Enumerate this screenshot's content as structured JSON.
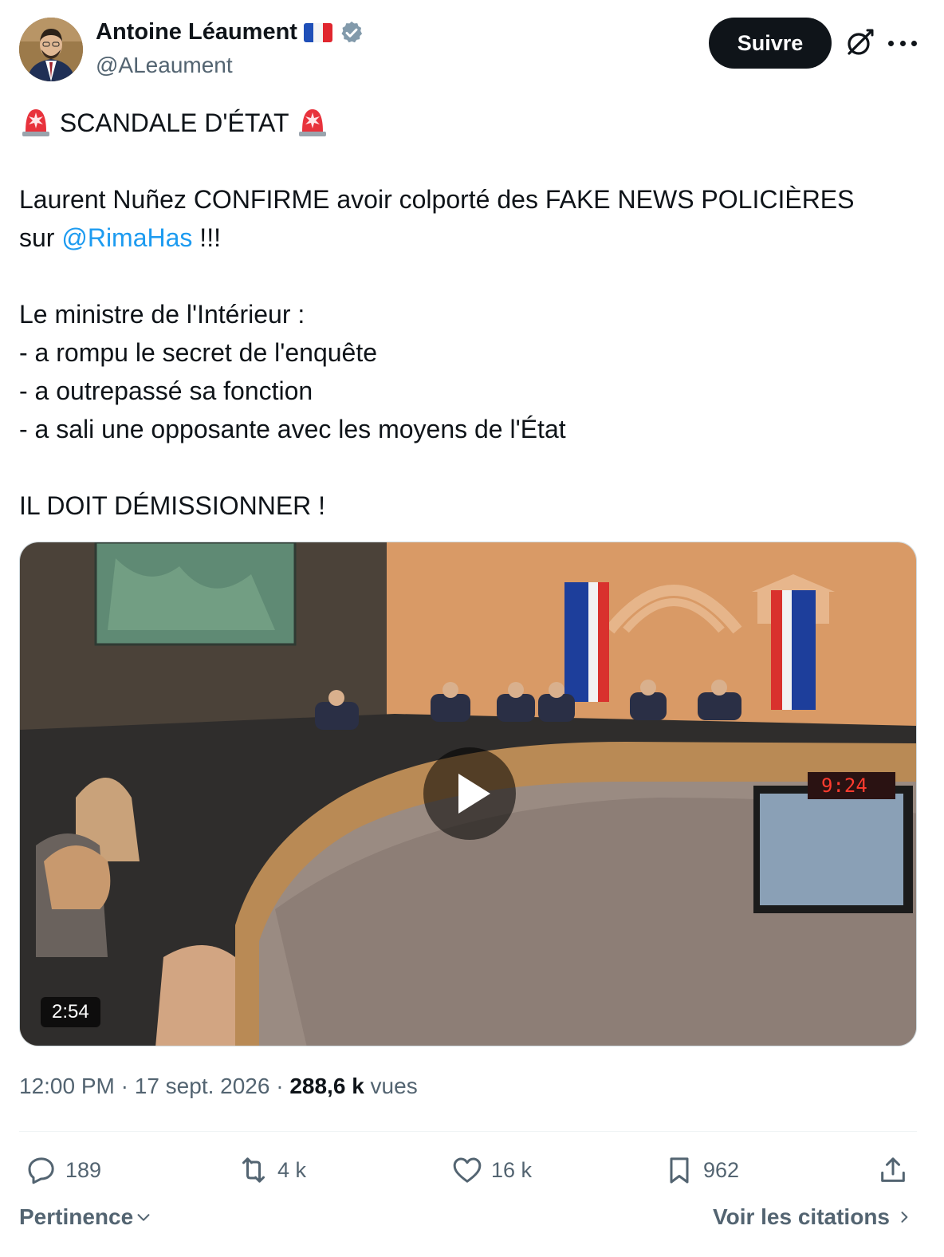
{
  "author": {
    "name": "Antoine Léaument",
    "handle": "@ALeaument",
    "flag_icon": "france-flag-icon",
    "verified_icon": "verified-badge-icon"
  },
  "header": {
    "follow_label": "Suivre",
    "grok_icon": "grok-icon",
    "more_icon": "more-options-icon"
  },
  "tweet": {
    "headline": "SCANDALE D'ÉTAT",
    "line1": "Laurent Nuñez CONFIRME avoir colporté des FAKE NEWS POLICIÈRES",
    "line2_prefix": "sur ",
    "mention": "@RimaHas",
    "line2_suffix": " !!!",
    "line3": "Le ministre de l'Intérieur :",
    "line4": "- a rompu le secret de l'enquête",
    "line5": "- a outrepassé sa fonction",
    "line6": "- a sali une opposante avec les moyens de l'État",
    "line7": "IL DOIT DÉMISSIONNER !"
  },
  "media": {
    "type": "video",
    "duration": "2:54",
    "clock_display": "9:24"
  },
  "meta": {
    "time": "12:00 PM",
    "date": "17 sept. 2026",
    "views_count": "288,6 k",
    "views_label": "vues"
  },
  "actions": {
    "replies": "189",
    "reposts": "4 k",
    "likes": "16 k",
    "bookmarks": "962"
  },
  "footer": {
    "sort_label": "Pertinence",
    "quotes_label": "Voir les citations"
  },
  "colors": {
    "link": "#1d9bf0",
    "text": "#0f1419",
    "muted": "#536471",
    "follow_bg": "#0f1419"
  }
}
